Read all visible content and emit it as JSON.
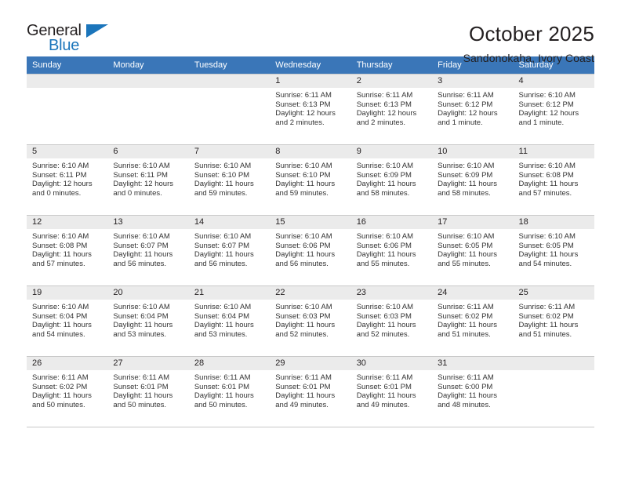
{
  "logo": {
    "word1": "General",
    "word2": "Blue",
    "triangle": "triangle-icon"
  },
  "header": {
    "month_title": "October 2025",
    "location": "Sandonokaha, Ivory Coast"
  },
  "calendar": {
    "weekday_headers": [
      "Sunday",
      "Monday",
      "Tuesday",
      "Wednesday",
      "Thursday",
      "Friday",
      "Saturday"
    ],
    "accent_color": "#3a76b8",
    "daynum_bg": "#ebebeb",
    "labels": {
      "sunrise": "Sunrise:",
      "sunset": "Sunset:",
      "daylight": "Daylight:"
    },
    "weeks": [
      [
        {
          "day": "",
          "empty": true
        },
        {
          "day": "",
          "empty": true
        },
        {
          "day": "",
          "empty": true
        },
        {
          "day": "1",
          "sunrise": "Sunrise: 6:11 AM",
          "sunset": "Sunset: 6:13 PM",
          "daylight_line1": "Daylight: 12 hours",
          "daylight_line2": "and 2 minutes."
        },
        {
          "day": "2",
          "sunrise": "Sunrise: 6:11 AM",
          "sunset": "Sunset: 6:13 PM",
          "daylight_line1": "Daylight: 12 hours",
          "daylight_line2": "and 2 minutes."
        },
        {
          "day": "3",
          "sunrise": "Sunrise: 6:11 AM",
          "sunset": "Sunset: 6:12 PM",
          "daylight_line1": "Daylight: 12 hours",
          "daylight_line2": "and 1 minute."
        },
        {
          "day": "4",
          "sunrise": "Sunrise: 6:10 AM",
          "sunset": "Sunset: 6:12 PM",
          "daylight_line1": "Daylight: 12 hours",
          "daylight_line2": "and 1 minute."
        }
      ],
      [
        {
          "day": "5",
          "sunrise": "Sunrise: 6:10 AM",
          "sunset": "Sunset: 6:11 PM",
          "daylight_line1": "Daylight: 12 hours",
          "daylight_line2": "and 0 minutes."
        },
        {
          "day": "6",
          "sunrise": "Sunrise: 6:10 AM",
          "sunset": "Sunset: 6:11 PM",
          "daylight_line1": "Daylight: 12 hours",
          "daylight_line2": "and 0 minutes."
        },
        {
          "day": "7",
          "sunrise": "Sunrise: 6:10 AM",
          "sunset": "Sunset: 6:10 PM",
          "daylight_line1": "Daylight: 11 hours",
          "daylight_line2": "and 59 minutes."
        },
        {
          "day": "8",
          "sunrise": "Sunrise: 6:10 AM",
          "sunset": "Sunset: 6:10 PM",
          "daylight_line1": "Daylight: 11 hours",
          "daylight_line2": "and 59 minutes."
        },
        {
          "day": "9",
          "sunrise": "Sunrise: 6:10 AM",
          "sunset": "Sunset: 6:09 PM",
          "daylight_line1": "Daylight: 11 hours",
          "daylight_line2": "and 58 minutes."
        },
        {
          "day": "10",
          "sunrise": "Sunrise: 6:10 AM",
          "sunset": "Sunset: 6:09 PM",
          "daylight_line1": "Daylight: 11 hours",
          "daylight_line2": "and 58 minutes."
        },
        {
          "day": "11",
          "sunrise": "Sunrise: 6:10 AM",
          "sunset": "Sunset: 6:08 PM",
          "daylight_line1": "Daylight: 11 hours",
          "daylight_line2": "and 57 minutes."
        }
      ],
      [
        {
          "day": "12",
          "sunrise": "Sunrise: 6:10 AM",
          "sunset": "Sunset: 6:08 PM",
          "daylight_line1": "Daylight: 11 hours",
          "daylight_line2": "and 57 minutes."
        },
        {
          "day": "13",
          "sunrise": "Sunrise: 6:10 AM",
          "sunset": "Sunset: 6:07 PM",
          "daylight_line1": "Daylight: 11 hours",
          "daylight_line2": "and 56 minutes."
        },
        {
          "day": "14",
          "sunrise": "Sunrise: 6:10 AM",
          "sunset": "Sunset: 6:07 PM",
          "daylight_line1": "Daylight: 11 hours",
          "daylight_line2": "and 56 minutes."
        },
        {
          "day": "15",
          "sunrise": "Sunrise: 6:10 AM",
          "sunset": "Sunset: 6:06 PM",
          "daylight_line1": "Daylight: 11 hours",
          "daylight_line2": "and 56 minutes."
        },
        {
          "day": "16",
          "sunrise": "Sunrise: 6:10 AM",
          "sunset": "Sunset: 6:06 PM",
          "daylight_line1": "Daylight: 11 hours",
          "daylight_line2": "and 55 minutes."
        },
        {
          "day": "17",
          "sunrise": "Sunrise: 6:10 AM",
          "sunset": "Sunset: 6:05 PM",
          "daylight_line1": "Daylight: 11 hours",
          "daylight_line2": "and 55 minutes."
        },
        {
          "day": "18",
          "sunrise": "Sunrise: 6:10 AM",
          "sunset": "Sunset: 6:05 PM",
          "daylight_line1": "Daylight: 11 hours",
          "daylight_line2": "and 54 minutes."
        }
      ],
      [
        {
          "day": "19",
          "sunrise": "Sunrise: 6:10 AM",
          "sunset": "Sunset: 6:04 PM",
          "daylight_line1": "Daylight: 11 hours",
          "daylight_line2": "and 54 minutes."
        },
        {
          "day": "20",
          "sunrise": "Sunrise: 6:10 AM",
          "sunset": "Sunset: 6:04 PM",
          "daylight_line1": "Daylight: 11 hours",
          "daylight_line2": "and 53 minutes."
        },
        {
          "day": "21",
          "sunrise": "Sunrise: 6:10 AM",
          "sunset": "Sunset: 6:04 PM",
          "daylight_line1": "Daylight: 11 hours",
          "daylight_line2": "and 53 minutes."
        },
        {
          "day": "22",
          "sunrise": "Sunrise: 6:10 AM",
          "sunset": "Sunset: 6:03 PM",
          "daylight_line1": "Daylight: 11 hours",
          "daylight_line2": "and 52 minutes."
        },
        {
          "day": "23",
          "sunrise": "Sunrise: 6:10 AM",
          "sunset": "Sunset: 6:03 PM",
          "daylight_line1": "Daylight: 11 hours",
          "daylight_line2": "and 52 minutes."
        },
        {
          "day": "24",
          "sunrise": "Sunrise: 6:11 AM",
          "sunset": "Sunset: 6:02 PM",
          "daylight_line1": "Daylight: 11 hours",
          "daylight_line2": "and 51 minutes."
        },
        {
          "day": "25",
          "sunrise": "Sunrise: 6:11 AM",
          "sunset": "Sunset: 6:02 PM",
          "daylight_line1": "Daylight: 11 hours",
          "daylight_line2": "and 51 minutes."
        }
      ],
      [
        {
          "day": "26",
          "sunrise": "Sunrise: 6:11 AM",
          "sunset": "Sunset: 6:02 PM",
          "daylight_line1": "Daylight: 11 hours",
          "daylight_line2": "and 50 minutes."
        },
        {
          "day": "27",
          "sunrise": "Sunrise: 6:11 AM",
          "sunset": "Sunset: 6:01 PM",
          "daylight_line1": "Daylight: 11 hours",
          "daylight_line2": "and 50 minutes."
        },
        {
          "day": "28",
          "sunrise": "Sunrise: 6:11 AM",
          "sunset": "Sunset: 6:01 PM",
          "daylight_line1": "Daylight: 11 hours",
          "daylight_line2": "and 50 minutes."
        },
        {
          "day": "29",
          "sunrise": "Sunrise: 6:11 AM",
          "sunset": "Sunset: 6:01 PM",
          "daylight_line1": "Daylight: 11 hours",
          "daylight_line2": "and 49 minutes."
        },
        {
          "day": "30",
          "sunrise": "Sunrise: 6:11 AM",
          "sunset": "Sunset: 6:01 PM",
          "daylight_line1": "Daylight: 11 hours",
          "daylight_line2": "and 49 minutes."
        },
        {
          "day": "31",
          "sunrise": "Sunrise: 6:11 AM",
          "sunset": "Sunset: 6:00 PM",
          "daylight_line1": "Daylight: 11 hours",
          "daylight_line2": "and 48 minutes."
        },
        {
          "day": "",
          "empty": true
        }
      ]
    ]
  }
}
